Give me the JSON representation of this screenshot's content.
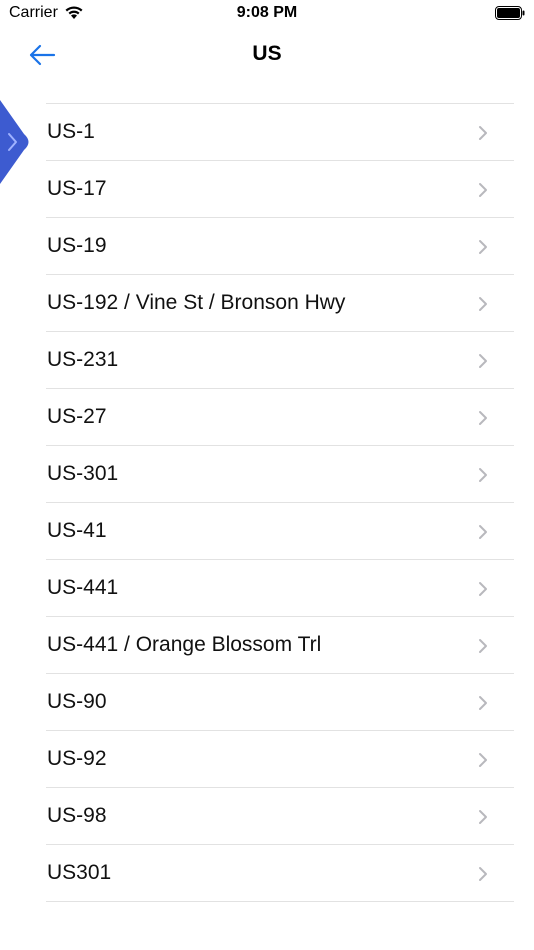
{
  "status_bar": {
    "carrier": "Carrier",
    "time": "9:08 PM"
  },
  "nav": {
    "title": "US",
    "back_icon": "arrow-left-icon"
  },
  "colors": {
    "accent": "#1a73e8",
    "side_tab": "#3d5bd0",
    "separator": "#e2e2e2",
    "chevron": "#b8b8bd"
  },
  "list": {
    "items": [
      {
        "label": "US-1"
      },
      {
        "label": "US-17"
      },
      {
        "label": "US-19"
      },
      {
        "label": "US-192 / Vine St / Bronson Hwy"
      },
      {
        "label": "US-231"
      },
      {
        "label": "US-27"
      },
      {
        "label": "US-301"
      },
      {
        "label": "US-41"
      },
      {
        "label": "US-441"
      },
      {
        "label": "US-441 / Orange Blossom Trl"
      },
      {
        "label": "US-90"
      },
      {
        "label": "US-92"
      },
      {
        "label": "US-98"
      },
      {
        "label": "US301"
      }
    ]
  }
}
